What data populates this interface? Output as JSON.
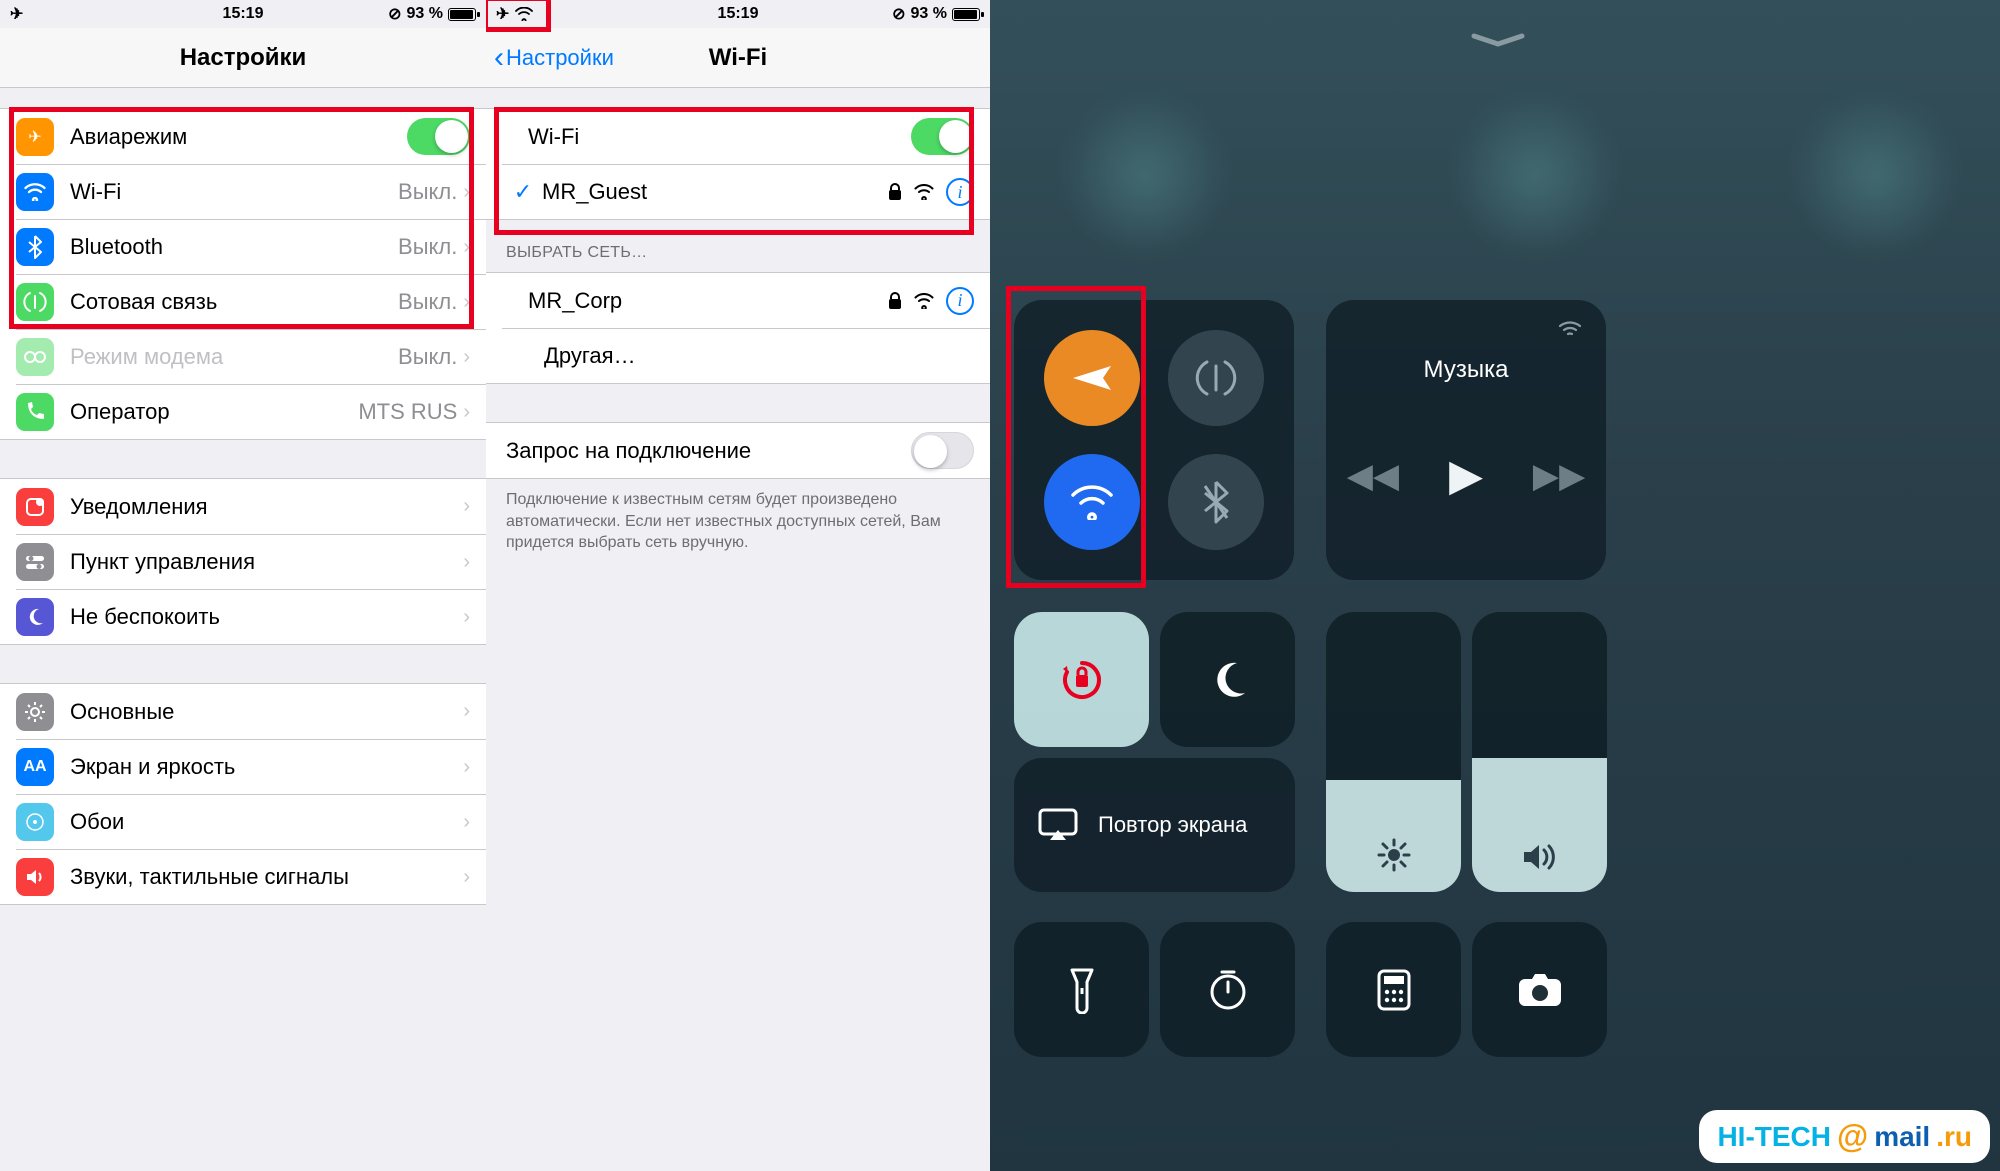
{
  "status": {
    "time": "15:19",
    "battery_pct": "93 %"
  },
  "panel1": {
    "title": "Настройки",
    "rows": {
      "airplane": "Авиарежим",
      "wifi": "Wi-Fi",
      "wifi_detail": "Выкл.",
      "bt": "Bluetooth",
      "bt_detail": "Выкл.",
      "cell": "Сотовая связь",
      "cell_detail": "Выкл.",
      "hotspot": "Режим модема",
      "hotspot_detail": "Выкл.",
      "carrier": "Оператор",
      "carrier_detail": "MTS RUS",
      "notif": "Уведомления",
      "cc": "Пункт управления",
      "dnd": "Не беспокоить",
      "general": "Основные",
      "display": "Экран и яркость",
      "wall": "Обои",
      "sounds": "Звуки, тактильные сигналы"
    }
  },
  "panel2": {
    "back": "Настройки",
    "title": "Wi-Fi",
    "toggle_label": "Wi-Fi",
    "connected": "MR_Guest",
    "section": "ВЫБРАТЬ СЕТЬ…",
    "network1": "MR_Corp",
    "other": "Другая…",
    "ask_label": "Запрос на подключение",
    "footnote": "Подключение к известным сетям будет произведено автоматически. Если нет известных доступных сетей, Вам придется выбрать сеть вручную."
  },
  "panel3": {
    "music": "Музыка",
    "mirror": "Повтор экрана"
  },
  "watermark": {
    "a": "HI-TECH",
    "b": "@",
    "c": "mail",
    "d": ".ru"
  }
}
